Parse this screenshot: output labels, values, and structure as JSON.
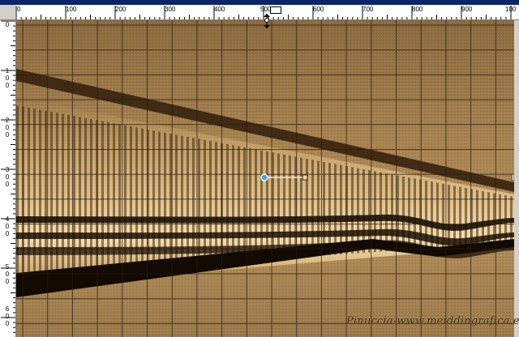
{
  "ruler": {
    "horizontal_labels": [
      "0",
      "100",
      "200",
      "300",
      "400",
      "500",
      "600",
      "700",
      "800",
      "900",
      "100"
    ],
    "vertical_labels": [
      "0",
      "100",
      "200",
      "300",
      "400",
      "500",
      "600"
    ]
  },
  "canvas": {
    "watermark_text": "Pinuccia-www.meiddingrafica.eu"
  },
  "colors": {
    "canvas_base": "#9a7a4e",
    "grid": "#2b1c0c",
    "dark_band": "#3b2611",
    "highlight": "#f2cf8f",
    "ruler_bg": "#ffffff",
    "window_chrome": "#d4d0c8"
  },
  "icons": [
    "rotation-handle-icon",
    "pick-handle-icon",
    "ruler-marker-icon"
  ]
}
